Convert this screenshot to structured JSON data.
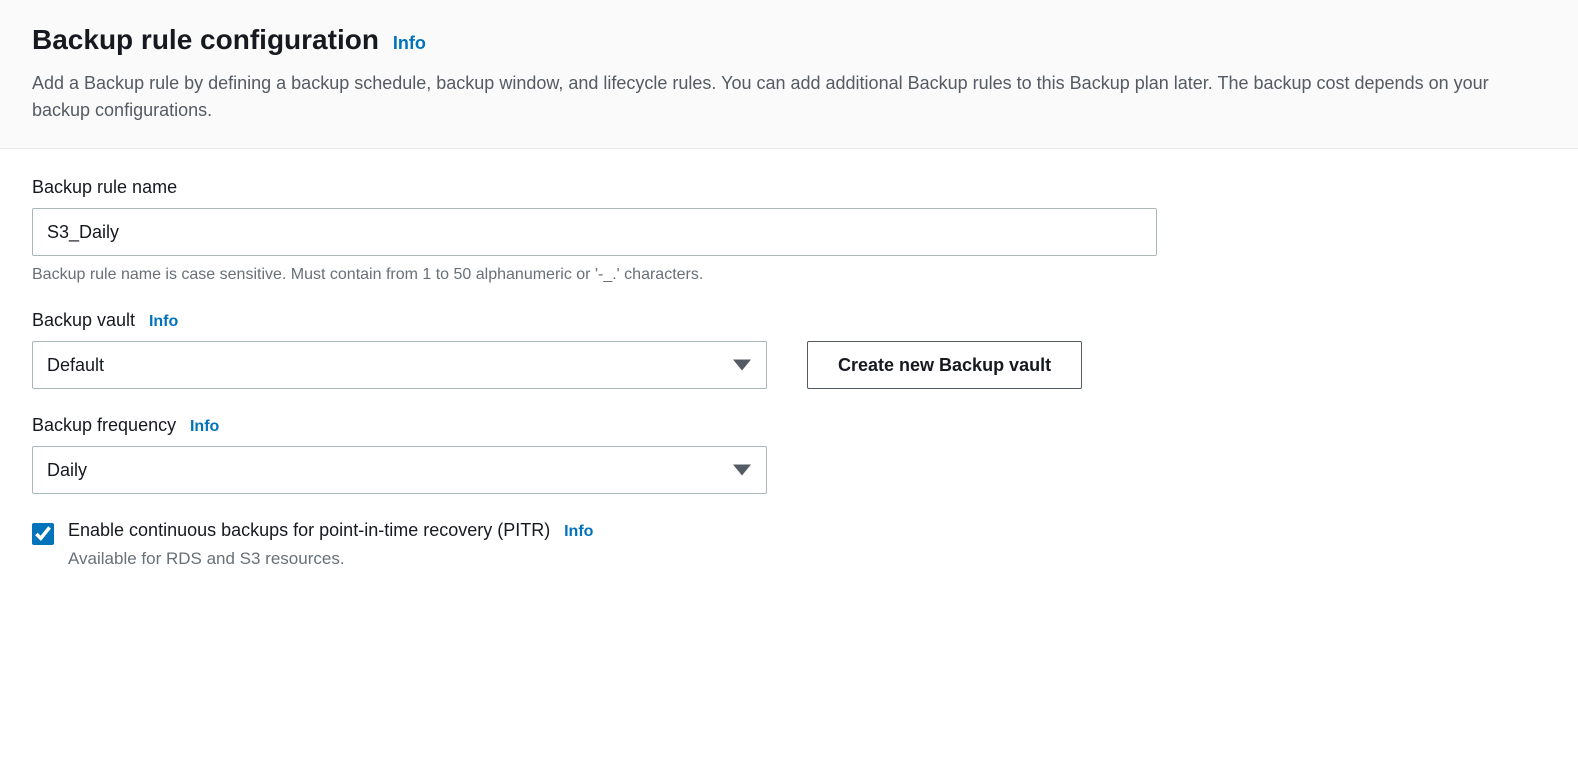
{
  "header": {
    "title": "Backup rule configuration",
    "info_label": "Info",
    "description": "Add a Backup rule by defining a backup schedule, backup window, and lifecycle rules. You can add additional Backup rules to this Backup plan later. The backup cost depends on your backup configurations."
  },
  "rule_name": {
    "label": "Backup rule name",
    "value": "S3_Daily",
    "helper": "Backup rule name is case sensitive. Must contain from 1 to 50 alphanumeric or '-_.' characters."
  },
  "vault": {
    "label": "Backup vault",
    "info_label": "Info",
    "selected": "Default",
    "create_button": "Create new Backup vault"
  },
  "frequency": {
    "label": "Backup frequency",
    "info_label": "Info",
    "selected": "Daily"
  },
  "pitr": {
    "checked": true,
    "label": "Enable continuous backups for point-in-time recovery (PITR)",
    "info_label": "Info",
    "helper": "Available for RDS and S3 resources."
  }
}
